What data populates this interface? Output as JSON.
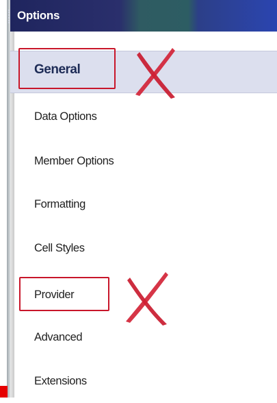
{
  "window": {
    "title": "Options"
  },
  "nav": {
    "items": [
      {
        "label": "General",
        "selected": true
      },
      {
        "label": "Data Options"
      },
      {
        "label": "Member Options"
      },
      {
        "label": "Formatting"
      },
      {
        "label": "Cell Styles"
      },
      {
        "label": "Provider"
      },
      {
        "label": "Advanced"
      },
      {
        "label": "Extensions"
      }
    ]
  },
  "annotations": {
    "color": "#c8162a",
    "marks": [
      {
        "target": "General",
        "mark": "x-mark"
      },
      {
        "target": "Provider",
        "mark": "x-mark"
      }
    ]
  }
}
